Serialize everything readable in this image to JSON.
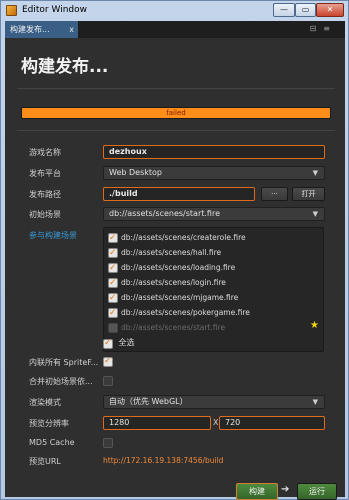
{
  "window": {
    "title": "Editor Window",
    "controls": {
      "minimize": "—",
      "maximize": "▭",
      "close": "✕"
    }
  },
  "tab": {
    "label": "构建发布...",
    "close": "x",
    "tools": "⊟≡"
  },
  "heading": "构建发布...",
  "progress": {
    "label": "failed",
    "percent": 100,
    "color": "#ff8d1a"
  },
  "form": {
    "game_name": {
      "label": "游戏名称",
      "value": "dezhoux"
    },
    "platform": {
      "label": "发布平台",
      "value": "Web Desktop"
    },
    "path": {
      "label": "发布路径",
      "value": "./build",
      "browse": "···",
      "open": "打开"
    },
    "start_scene": {
      "label": "初始场景",
      "value": "db://assets/scenes/start.fire"
    },
    "scenes": {
      "label": "参与构建场景",
      "items": [
        {
          "text": "db://assets/scenes/createrole.fire",
          "checked": true,
          "enabled": true
        },
        {
          "text": "db://assets/scenes/hall.fire",
          "checked": true,
          "enabled": true
        },
        {
          "text": "db://assets/scenes/loading.fire",
          "checked": true,
          "enabled": true
        },
        {
          "text": "db://assets/scenes/login.fire",
          "checked": true,
          "enabled": true
        },
        {
          "text": "db://assets/scenes/mjgame.fire",
          "checked": true,
          "enabled": true
        },
        {
          "text": "db://assets/scenes/pokergame.fire",
          "checked": true,
          "enabled": true
        },
        {
          "text": "db://assets/scenes/start.fire",
          "checked": true,
          "enabled": false
        }
      ],
      "select_all": "全选"
    },
    "inline_sprite": {
      "label": "内联所有 SpriteF...",
      "checked": true
    },
    "merge_scene": {
      "label": "合并初始场景依...",
      "checked": false
    },
    "render_mode": {
      "label": "渲染模式",
      "value": "自动（优先 WebGL）"
    },
    "preview_res": {
      "label": "预览分辨率",
      "width": "1280",
      "x": "X",
      "height": "720"
    },
    "md5": {
      "label": "MD5 Cache",
      "checked": false
    },
    "preview_url": {
      "label": "预览URL",
      "value": "http://172.16.19.138:7456/build"
    }
  },
  "buttons": {
    "build": "构建",
    "arrow": "➔",
    "run": "运行"
  }
}
